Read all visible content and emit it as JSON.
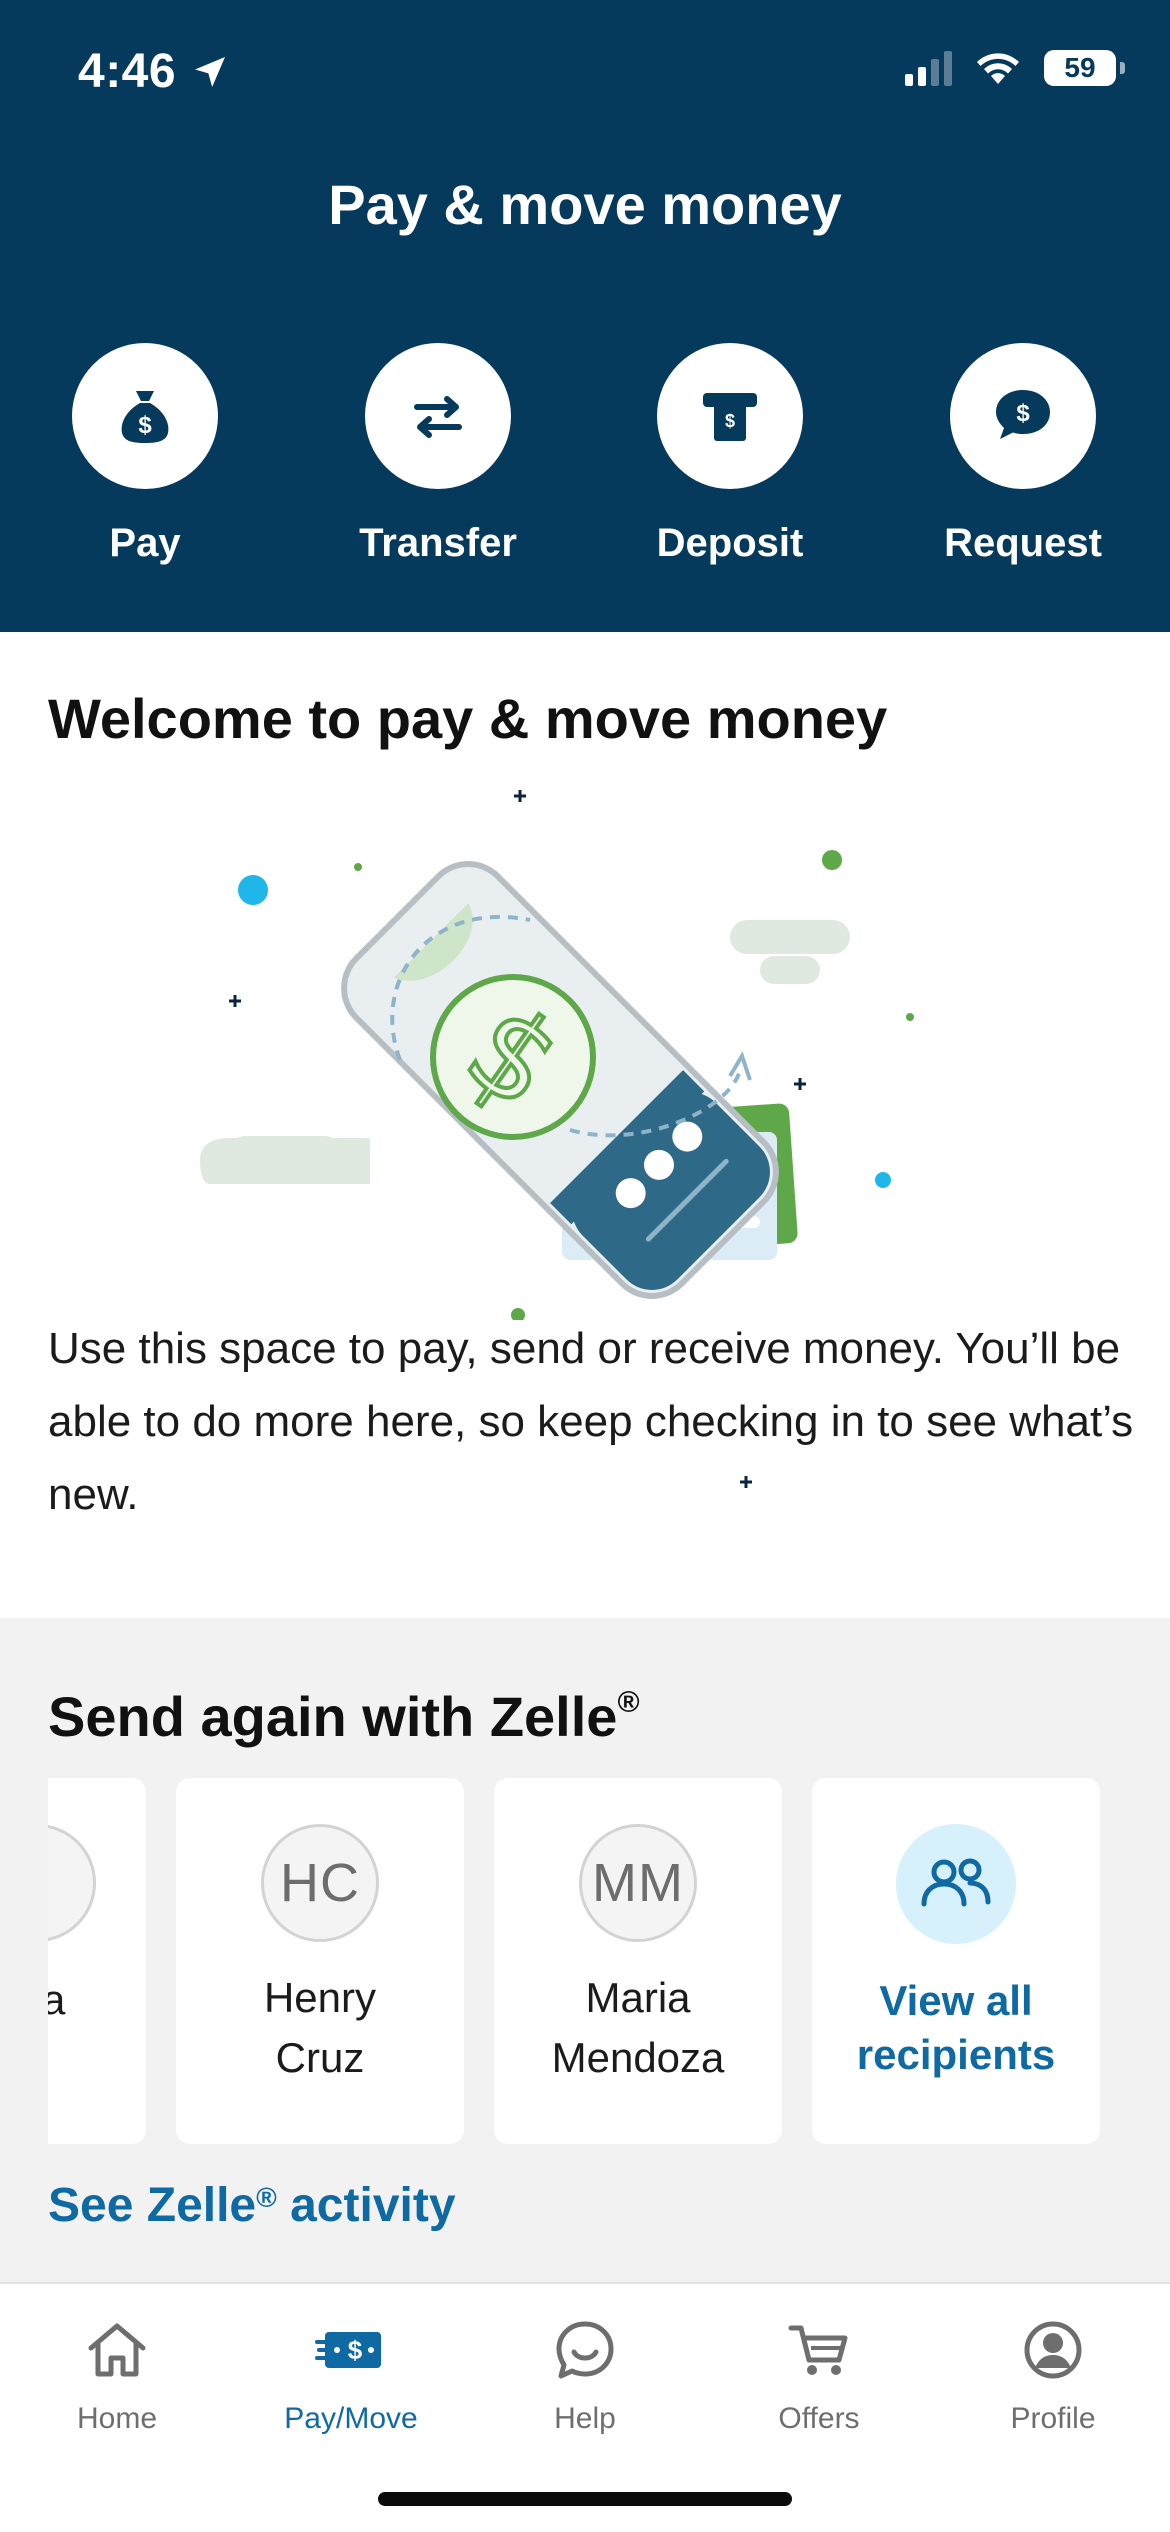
{
  "status_bar": {
    "time": "4:46",
    "battery": "59"
  },
  "header": {
    "title": "Pay & move money"
  },
  "actions": [
    {
      "label": "Pay",
      "icon": "money-bag-icon"
    },
    {
      "label": "Transfer",
      "icon": "transfer-arrows-icon"
    },
    {
      "label": "Deposit",
      "icon": "check-deposit-icon"
    },
    {
      "label": "Request",
      "icon": "dollar-chat-icon"
    }
  ],
  "welcome": {
    "title": "Welcome to pay & move money",
    "text": "Use this space to pay, send or receive money. You’ll be able to do more here, so keep checking in to see what’s new."
  },
  "zelle": {
    "title": "Send again with Zelle",
    "title_mark": "®",
    "partial_name_fragment": "a",
    "recipients": [
      {
        "initials": "HC",
        "first": "Henry",
        "last": "Cruz"
      },
      {
        "initials": "MM",
        "first": "Maria",
        "last": "Mendoza"
      }
    ],
    "view_all": {
      "line1": "View all",
      "line2": "recipients"
    },
    "activity_link": {
      "pre": "See Zelle",
      "mark": "®",
      "post": " activity"
    }
  },
  "tabbar": {
    "items": [
      {
        "label": "Home",
        "icon": "home-icon",
        "active": false
      },
      {
        "label": "Pay/Move",
        "icon": "pay-move-icon",
        "active": true
      },
      {
        "label": "Help",
        "icon": "help-chat-icon",
        "active": false
      },
      {
        "label": "Offers",
        "icon": "cart-icon",
        "active": false
      },
      {
        "label": "Profile",
        "icon": "profile-icon",
        "active": false
      }
    ]
  },
  "colors": {
    "header_bg": "#053a5c",
    "accent_blue": "#0f6aa4",
    "section_bg": "#f2f2f2",
    "zelle_avatar_bg": "#d6f1fb"
  }
}
